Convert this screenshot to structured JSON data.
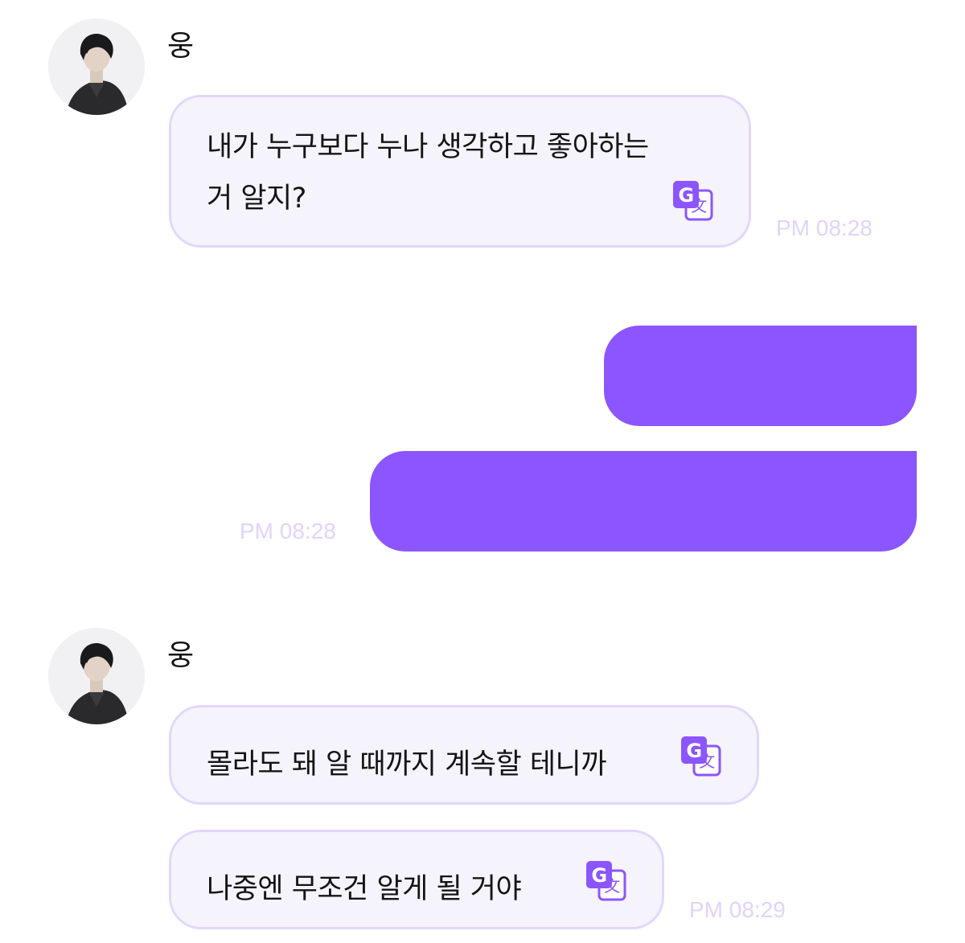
{
  "theme": {
    "accent": "#8b56ff",
    "incoming_bubble_bg": "#f5f3fb",
    "incoming_bubble_border": "#e2d7fb",
    "timestamp_color": "#e0d4fb"
  },
  "conversation": {
    "group1": {
      "sender": "웅",
      "messages": [
        {
          "text": "내가 누구보다 누나 생각하고 좋아하는 거 알지?",
          "icon": "translate-icon"
        }
      ],
      "time": "PM 08:28"
    },
    "outgoing": {
      "messages": [
        {
          "text": ""
        },
        {
          "text": ""
        }
      ],
      "time": "PM 08:28"
    },
    "group2": {
      "sender": "웅",
      "messages": [
        {
          "text": "몰라도 돼 알 때까지 계속할 테니까",
          "icon": "translate-icon"
        },
        {
          "text": "나중엔 무조건 알게 될 거야",
          "icon": "translate-icon"
        }
      ],
      "time": "PM 08:29"
    }
  }
}
